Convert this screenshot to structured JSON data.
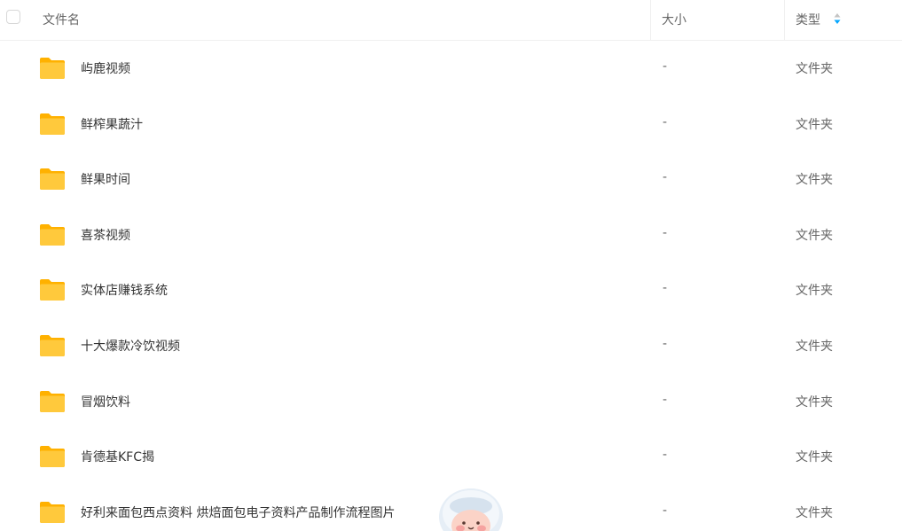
{
  "header": {
    "name_label": "文件名",
    "size_label": "大小",
    "type_label": "类型",
    "sort_icon": "sort-icon",
    "select_all_icon": "checkbox-icon"
  },
  "colors": {
    "folder": "#FFC93C",
    "folder_back": "#FFB100",
    "sort_active": "#06A7FF",
    "sort_inactive": "#C4C4C4"
  },
  "rows": [
    {
      "name": "屿鹿视频",
      "size": "-",
      "type": "文件夹"
    },
    {
      "name": "鲜榨果蔬汁",
      "size": "-",
      "type": "文件夹"
    },
    {
      "name": "鲜果时间",
      "size": "-",
      "type": "文件夹"
    },
    {
      "name": "喜茶视频",
      "size": "-",
      "type": "文件夹"
    },
    {
      "name": "实体店赚钱系统",
      "size": "-",
      "type": "文件夹"
    },
    {
      "name": "十大爆款冷饮视频",
      "size": "-",
      "type": "文件夹"
    },
    {
      "name": "冒烟饮料",
      "size": "-",
      "type": "文件夹"
    },
    {
      "name": "肯德基KFC揭",
      "size": "-",
      "type": "文件夹"
    },
    {
      "name": "好利来面包西点资料 烘焙面包电子资料产品制作流程图片",
      "size": "-",
      "type": "文件夹"
    }
  ],
  "mascot_icon": "mascot-icon"
}
